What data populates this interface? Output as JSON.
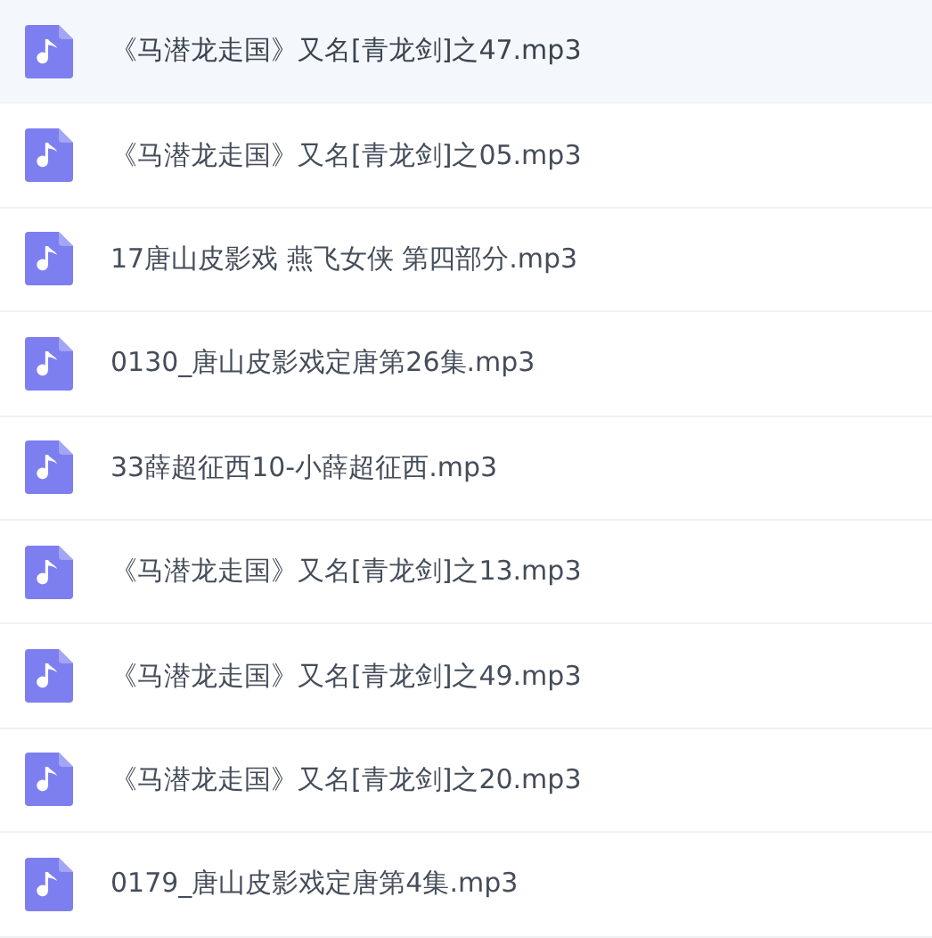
{
  "files": [
    {
      "name": "《马潜龙走国》又名[青龙剑]之47.mp3",
      "selected": true
    },
    {
      "name": "《马潜龙走国》又名[青龙剑]之05.mp3",
      "selected": false
    },
    {
      "name": "17唐山皮影戏 燕飞女侠 第四部分.mp3",
      "selected": false
    },
    {
      "name": "0130_唐山皮影戏定唐第26集.mp3",
      "selected": false
    },
    {
      "name": "33薛超征西10-小薛超征西.mp3",
      "selected": false
    },
    {
      "name": "《马潜龙走国》又名[青龙剑]之13.mp3",
      "selected": false
    },
    {
      "name": "《马潜龙走国》又名[青龙剑]之49.mp3",
      "selected": false
    },
    {
      "name": "《马潜龙走国》又名[青龙剑]之20.mp3",
      "selected": false
    },
    {
      "name": "0179_唐山皮影戏定唐第4集.mp3",
      "selected": false
    }
  ]
}
